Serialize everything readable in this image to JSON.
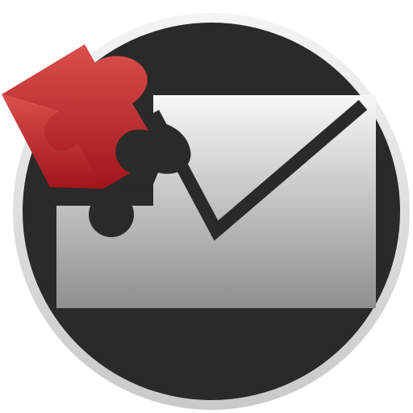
{
  "app_icon": {
    "icon": "mail-plugin-icon",
    "elements": {
      "ring": "badge-ring",
      "disc": "badge-disc",
      "envelope": "envelope-icon",
      "puzzle": "puzzle-piece-icon"
    },
    "colors": {
      "ring_light": "#f4f4f4",
      "ring_dark": "#c9c9c9",
      "disc": "#2b2a2b",
      "envelope_light": "#f7f7f7",
      "envelope_dark": "#8f8f8f",
      "envelope_line": "#2b2a2b",
      "puzzle_light": "#d9504c",
      "puzzle_dark": "#a1151b"
    }
  }
}
